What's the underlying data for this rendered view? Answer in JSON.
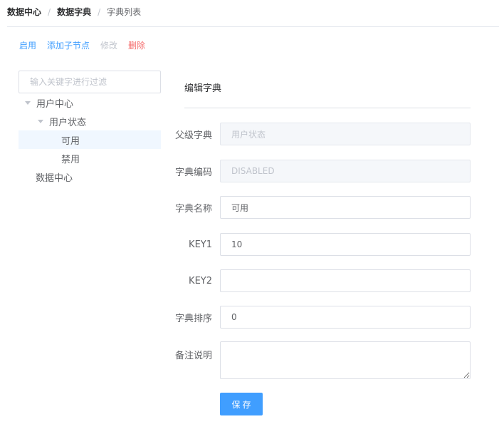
{
  "breadcrumb": [
    "数据中心",
    "数据字典",
    "字典列表"
  ],
  "breadcrumb_separator": "/",
  "toolbar": {
    "enable": "启用",
    "add_child": "添加子节点",
    "edit": "修改",
    "delete": "删除"
  },
  "filter": {
    "placeholder": "输入关键字进行过滤"
  },
  "tree": {
    "root1": "用户中心",
    "child1": "用户状态",
    "leaf1": "可用",
    "leaf2": "禁用",
    "root2": "数据中心"
  },
  "panel": {
    "title": "编辑字典"
  },
  "form": {
    "parent": {
      "label": "父级字典",
      "value": "用户状态"
    },
    "code": {
      "label": "字典编码",
      "value": "DISABLED"
    },
    "name": {
      "label": "字典名称",
      "value": "可用"
    },
    "key1": {
      "label": "KEY1",
      "value": "10"
    },
    "key2": {
      "label": "KEY2",
      "value": ""
    },
    "sort": {
      "label": "字典排序",
      "value": "0"
    },
    "remark": {
      "label": "备注说明",
      "value": ""
    }
  },
  "save_button": "保存",
  "colors": {
    "primary": "#409eff",
    "danger": "#f56c6c",
    "selected_bg": "#f0f7ff"
  }
}
